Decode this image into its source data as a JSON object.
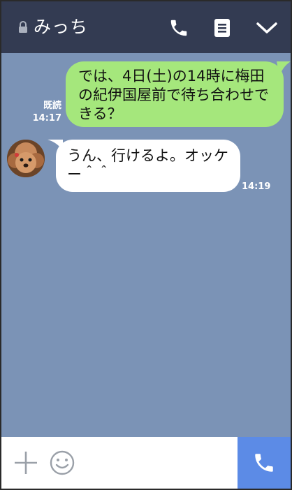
{
  "header": {
    "contact_name": "みっち",
    "icons": {
      "lock": "lock-icon",
      "call": "phone-icon",
      "notes": "note-icon",
      "collapse": "chevron-down-icon"
    }
  },
  "messages": [
    {
      "direction": "sent",
      "text": "では、4日(土)の14時に梅田の紀伊国屋前で待ち合わせできる？",
      "read_label": "既読",
      "time": "14:17"
    },
    {
      "direction": "received",
      "text": "うん、行けるよ。オッケー＾＾",
      "time": "14:19",
      "avatar": "dog-avatar"
    }
  ],
  "footer": {
    "icons": {
      "plus": "plus-icon",
      "emoji": "smiley-icon",
      "call": "phone-icon"
    }
  },
  "colors": {
    "header_bg": "#333b52",
    "chat_bg": "#7b93b6",
    "sent_bubble": "#a5e77c",
    "received_bubble": "#ffffff",
    "call_button": "#5c8be6"
  }
}
